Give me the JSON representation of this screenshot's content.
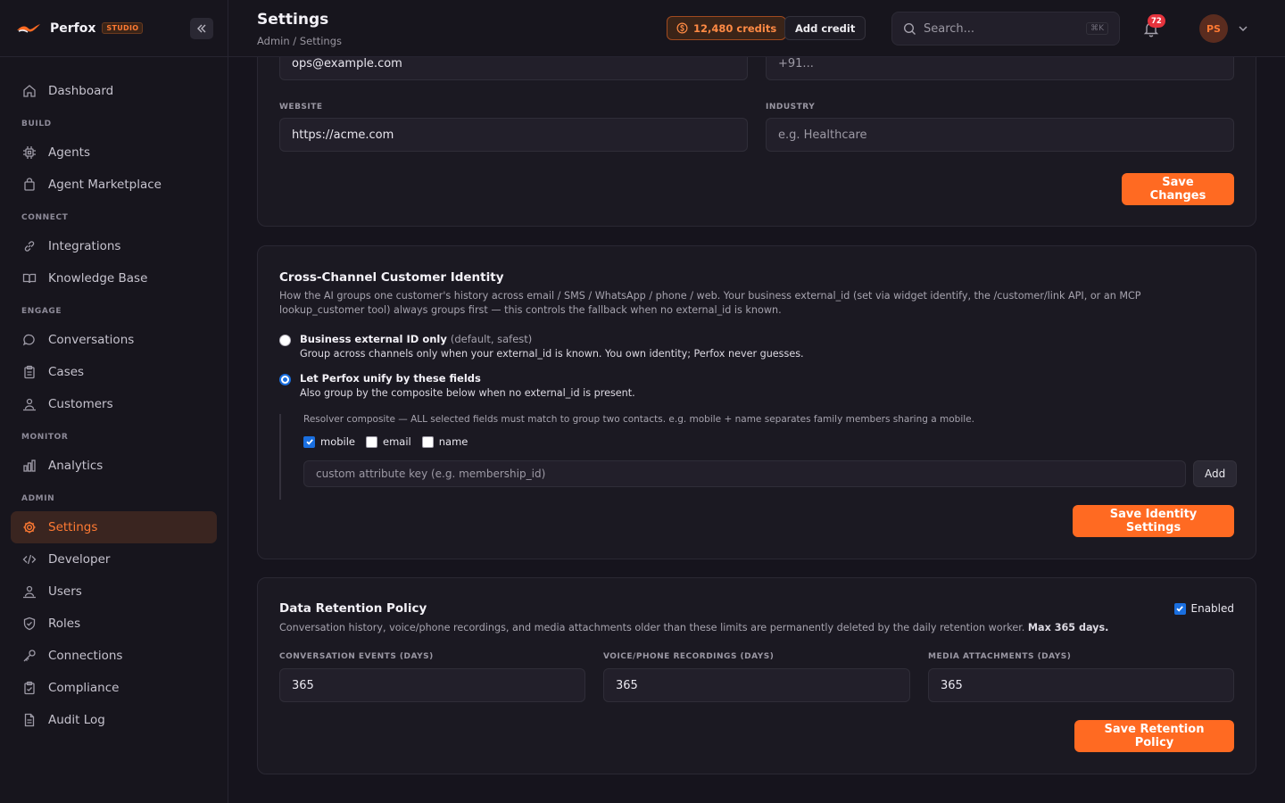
{
  "brand": {
    "name": "Perfox",
    "badge": "STUDIO"
  },
  "sidebar": {
    "top_item": {
      "label": "Dashboard"
    },
    "sections": {
      "build": {
        "title": "BUILD",
        "items": [
          "Agents",
          "Agent Marketplace"
        ]
      },
      "connect": {
        "title": "CONNECT",
        "items": [
          "Integrations",
          "Knowledge Base"
        ]
      },
      "engage": {
        "title": "ENGAGE",
        "items": [
          "Conversations",
          "Cases",
          "Customers"
        ]
      },
      "monitor": {
        "title": "MONITOR",
        "items": [
          "Analytics"
        ]
      },
      "admin": {
        "title": "ADMIN",
        "items": [
          "Settings",
          "Developer",
          "Users",
          "Roles",
          "Connections",
          "Compliance",
          "Audit Log"
        ]
      }
    },
    "active_item": "Settings"
  },
  "header": {
    "title": "Settings",
    "breadcrumb": "Admin / Settings",
    "credits_label": "12,480 credits",
    "add_credit_label": "Add credit",
    "search_placeholder": "Search...",
    "search_shortcut": "⌘K",
    "notification_count": "72",
    "avatar_initials": "PS"
  },
  "profile_card": {
    "email_value": "ops@example.com",
    "phone_placeholder": "+91...",
    "website_label": "WEBSITE",
    "website_value": "https://acme.com",
    "industry_label": "INDUSTRY",
    "industry_placeholder": "e.g. Healthcare",
    "save_label": "Save Changes"
  },
  "identity_card": {
    "title": "Cross-Channel Customer Identity",
    "desc_line1": "How the AI groups one customer's history across email / SMS / WhatsApp / phone / web. Your business external_id  (set via widget identify, the /customer/link API, or an MCP",
    "desc_line2": "lookup_customer tool) always groups first — this controls the fallback when no external_id is known.",
    "option1": {
      "title": "Business external ID only",
      "hint": "(default, safest)",
      "desc": "Group across channels only when your external_id is known. You own identity; Perfox never guesses."
    },
    "option2": {
      "title": "Let Perfox unify by these fields",
      "desc": "Also group by the composite below when no external_id is present."
    },
    "resolver_desc": "Resolver composite — ALL selected fields must match to group two contacts. e.g. mobile + name separates family members sharing a mobile.",
    "fields": [
      {
        "label": "mobile",
        "checked": true
      },
      {
        "label": "email",
        "checked": false
      },
      {
        "label": "name",
        "checked": false
      }
    ],
    "custom_attr_placeholder": "custom attribute key (e.g. membership_id)",
    "add_label": "Add",
    "save_label": "Save Identity Settings"
  },
  "retention_card": {
    "title": "Data Retention Policy",
    "enabled_label": "Enabled",
    "desc": "Conversation history, voice/phone recordings, and media attachments older than these limits are permanently deleted by the daily retention worker.",
    "desc_bold": "Max 365 days.",
    "conversation_label": "CONVERSATION EVENTS (DAYS)",
    "conversation_value": "365",
    "voice_label": "VOICE/PHONE RECORDINGS (DAYS)",
    "voice_value": "365",
    "media_label": "MEDIA ATTACHMENTS (DAYS)",
    "media_value": "365",
    "save_label": "Save Retention Policy"
  },
  "colors": {
    "accent": "#ff6a22",
    "background": "#16141d",
    "card": "#1b1922",
    "checkbox": "#1a6fe0"
  }
}
